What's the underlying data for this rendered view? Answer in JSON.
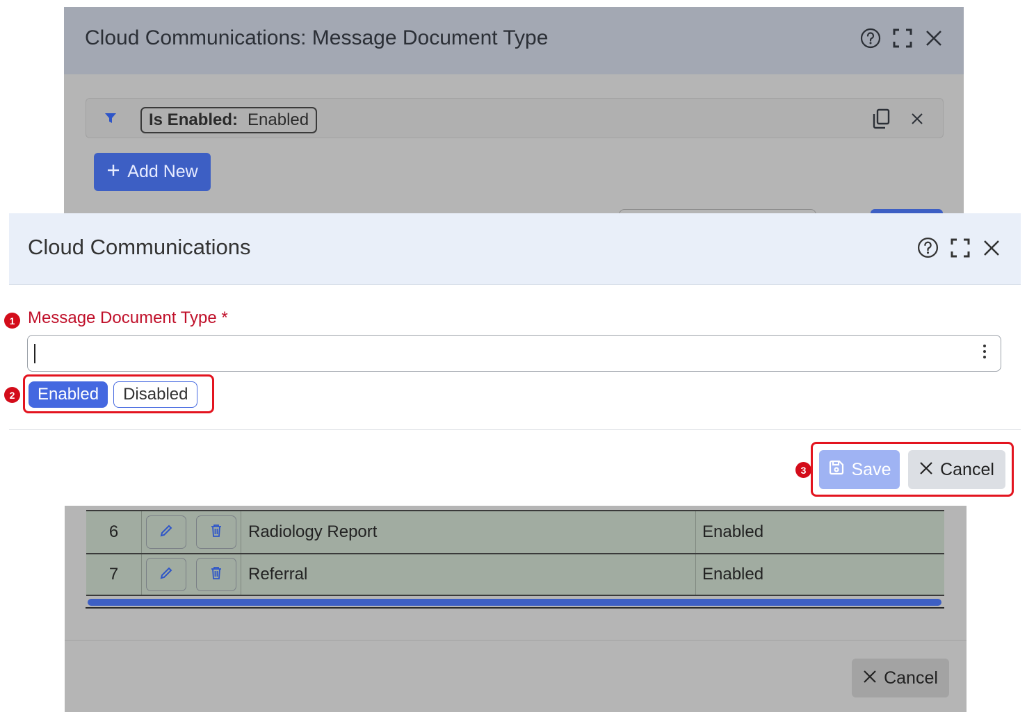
{
  "background_dialog": {
    "title": "Cloud Communications: Message Document Type",
    "filter_chip": {
      "label": "Is Enabled:",
      "value": "Enabled"
    },
    "add_new_label": "Add New",
    "table_rows": [
      {
        "num": "6",
        "name": "Radiology Report",
        "status": "Enabled"
      },
      {
        "num": "7",
        "name": "Referral",
        "status": "Enabled"
      }
    ],
    "cancel_label": "Cancel"
  },
  "dialog": {
    "title": "Cloud Communications",
    "field_label": "Message Document Type *",
    "field_value": "",
    "toggle": {
      "enabled_label": "Enabled",
      "disabled_label": "Disabled",
      "selected": "Enabled"
    },
    "save_label": "Save",
    "cancel_label": "Cancel"
  },
  "callouts": [
    "1",
    "2",
    "3"
  ],
  "colors": {
    "accent": "#4468e0",
    "required_label": "#c0102a",
    "callout": "#d30c1a",
    "save_disabled": "#9fb3f3"
  },
  "icons": [
    "help-icon",
    "maximize-icon",
    "close-icon",
    "filter-icon",
    "copy-icon",
    "plus-icon",
    "more-vertical-icon",
    "save-icon",
    "edit-icon",
    "trash-icon"
  ]
}
